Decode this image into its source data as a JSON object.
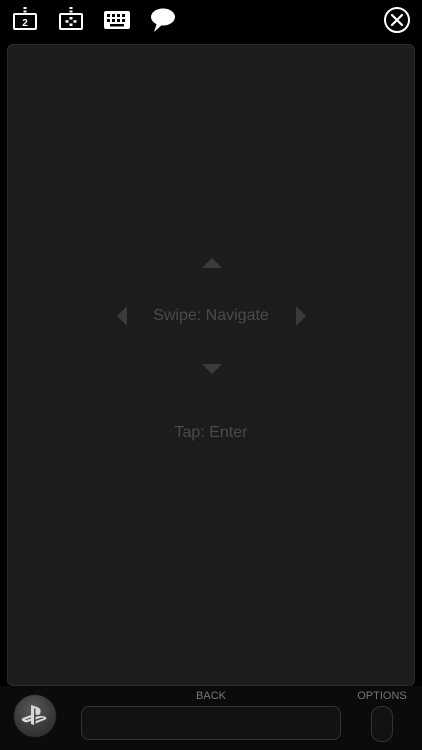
{
  "toolbar": {
    "icons": [
      "second-screen-2-icon",
      "dpad-controller-icon",
      "keyboard-icon",
      "chat-bubble-icon",
      "close-icon"
    ],
    "second_screen_badge": "2"
  },
  "touchpad": {
    "swipe_hint": "Swipe: Navigate",
    "tap_hint": "Tap: Enter"
  },
  "controls": {
    "back_label": "BACK",
    "options_label": "OPTIONS"
  },
  "colors": {
    "background": "#000000",
    "touchpad": "#1c1c1c",
    "hint_text": "#4a4a4a",
    "icon": "#ffffff"
  }
}
